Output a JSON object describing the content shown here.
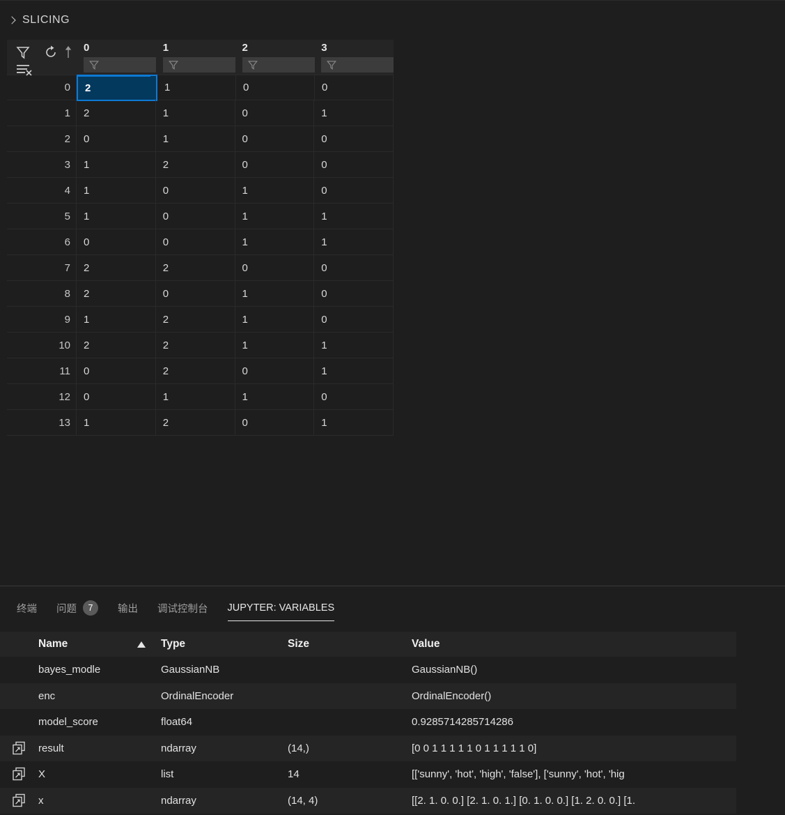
{
  "slicing": {
    "chevron_icon": "chevron-right-icon",
    "label": "SLICING"
  },
  "grid": {
    "toolbar": {
      "filter_icon": "filter-icon",
      "refresh_icon": "refresh-icon",
      "sort_asc_icon": "sort-ascending-icon",
      "clear_filter_icon": "clear-filter-icon"
    },
    "columns": [
      "0",
      "1",
      "2",
      "3"
    ],
    "filter_placeholder": "",
    "active_column_index": 0,
    "selected_cell": {
      "row": 0,
      "col": 0
    },
    "row_indices": [
      "0",
      "1",
      "2",
      "3",
      "4",
      "5",
      "6",
      "7",
      "8",
      "9",
      "10",
      "11",
      "12",
      "13"
    ],
    "rows": [
      [
        "2",
        "1",
        "0",
        "0"
      ],
      [
        "2",
        "1",
        "0",
        "1"
      ],
      [
        "0",
        "1",
        "0",
        "0"
      ],
      [
        "1",
        "2",
        "0",
        "0"
      ],
      [
        "1",
        "0",
        "1",
        "0"
      ],
      [
        "1",
        "0",
        "1",
        "1"
      ],
      [
        "0",
        "0",
        "1",
        "1"
      ],
      [
        "2",
        "2",
        "0",
        "0"
      ],
      [
        "2",
        "0",
        "1",
        "0"
      ],
      [
        "1",
        "2",
        "1",
        "0"
      ],
      [
        "2",
        "2",
        "1",
        "1"
      ],
      [
        "0",
        "2",
        "0",
        "1"
      ],
      [
        "0",
        "1",
        "1",
        "0"
      ],
      [
        "1",
        "2",
        "0",
        "1"
      ]
    ]
  },
  "panel": {
    "tabs": [
      {
        "label": "终端",
        "active": false,
        "badge": null
      },
      {
        "label": "问题",
        "active": false,
        "badge": "7"
      },
      {
        "label": "输出",
        "active": false,
        "badge": null
      },
      {
        "label": "调试控制台",
        "active": false,
        "badge": null
      },
      {
        "label": "JUPYTER: VARIABLES",
        "active": true,
        "badge": null
      }
    ]
  },
  "variables": {
    "headers": {
      "name": "Name",
      "type": "Type",
      "size": "Size",
      "value": "Value",
      "sort_icon": "sort-ascending-triangle-icon"
    },
    "rows": [
      {
        "has_viewer_icon": false,
        "viewer_icon": "open-in-data-viewer-icon",
        "name": "bayes_modle",
        "type": "GaussianNB",
        "size": "",
        "value": "GaussianNB()"
      },
      {
        "has_viewer_icon": false,
        "viewer_icon": "open-in-data-viewer-icon",
        "name": "enc",
        "type": "OrdinalEncoder",
        "size": "",
        "value": "OrdinalEncoder()"
      },
      {
        "has_viewer_icon": false,
        "viewer_icon": "open-in-data-viewer-icon",
        "name": "model_score",
        "type": "float64",
        "size": "",
        "value": "0.9285714285714286"
      },
      {
        "has_viewer_icon": true,
        "viewer_icon": "open-in-data-viewer-icon",
        "name": "result",
        "type": "ndarray",
        "size": "(14,)",
        "value": "[0 0 1 1 1 1 1 0 1 1 1 1 1 0]"
      },
      {
        "has_viewer_icon": true,
        "viewer_icon": "open-in-data-viewer-icon",
        "name": "X",
        "type": "list",
        "size": "14",
        "value": "[['sunny', 'hot', 'high', 'false'], ['sunny', 'hot', 'hig"
      },
      {
        "has_viewer_icon": true,
        "viewer_icon": "open-in-data-viewer-icon",
        "name": "x",
        "type": "ndarray",
        "size": "(14, 4)",
        "value": "[[2. 1. 0. 0.] [2. 1. 0. 1.] [0. 1. 0. 0.] [1. 2. 0. 0.] [1."
      }
    ]
  },
  "colors": {
    "background": "#1e1e1e",
    "header_background": "#252526",
    "accent_blue": "#0e7ad4",
    "selected_cell_fill": "#04395e",
    "text": "#d4d4d4",
    "muted_text": "#9d9d9d",
    "badge_background": "#5a5a5a"
  }
}
